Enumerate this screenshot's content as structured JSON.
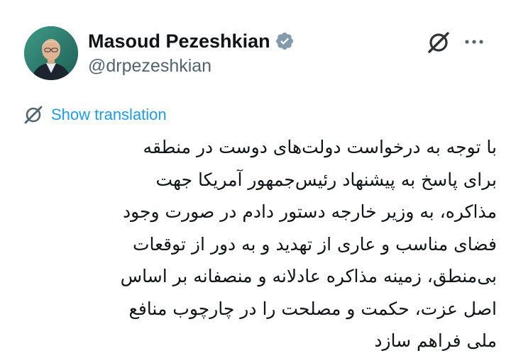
{
  "author": {
    "display_name": "Masoud Pezeshkian",
    "handle": "@drpezeshkian",
    "verified": true
  },
  "header": {
    "grok_icon": "grok-icon",
    "more_icon": "more-options-icon"
  },
  "translation": {
    "label": "Show translation",
    "icon": "translate-icon"
  },
  "tweet": {
    "lines": [
      "با توجه به درخواست دولت‌های دوست در منطقه",
      "برای پاسخ به پیشنهاد رئیس‌جمهور آمریکا جهت",
      "مذاکره، به وزیر خارجه دستور دادم در صورت وجود",
      "فضای مناسب و عاری از تهدید و به دور از توقعات",
      "بی‌منطق، زمینه مذاکره عادلانه و منصفانه بر اساس",
      "اصل عزت، حکمت و مصلحت را در چارچوب منافع",
      "ملی فراهم سازد"
    ]
  },
  "colors": {
    "text": "#0f1419",
    "muted": "#536471",
    "link": "#1d9bf0",
    "verified_badge": "#829aab"
  }
}
